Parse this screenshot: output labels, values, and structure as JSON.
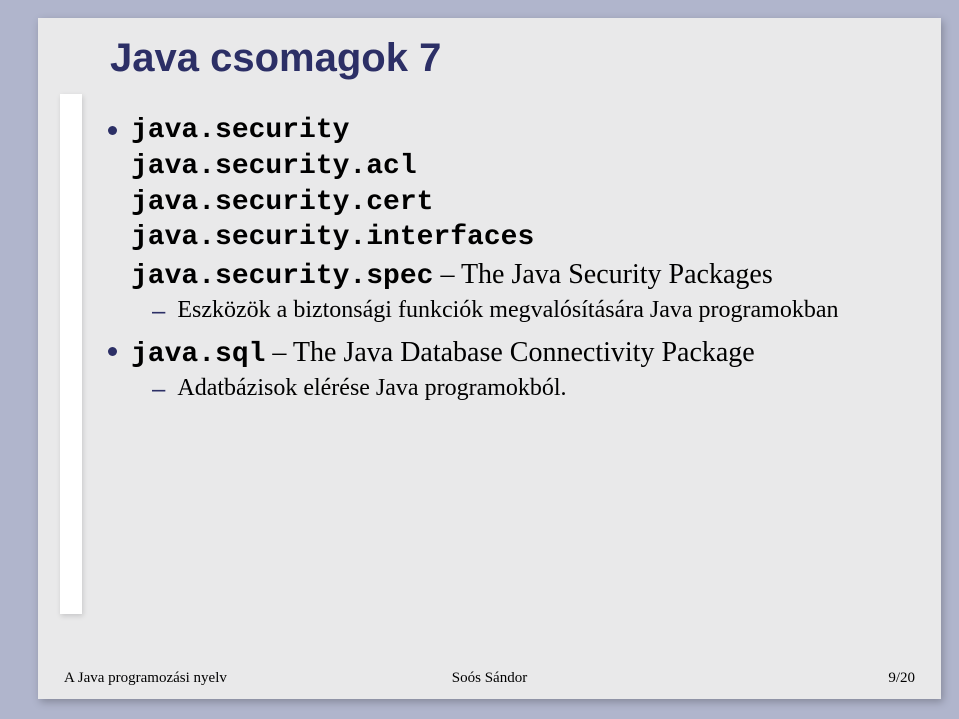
{
  "title": "Java csomagok 7",
  "bullets": [
    {
      "code_lines": [
        "java.security",
        "java.security.acl",
        "java.security.cert",
        "java.security.interfaces"
      ],
      "last_code": "java.security.spec",
      "last_desc": " – The Java Security Packages",
      "sub": "Eszközök a biztonsági funkciók megvalósítására Java programokban"
    },
    {
      "code": "java.sql",
      "desc": " – The Java Database Connectivity Package",
      "sub": "Adatbázisok elérése Java programokból."
    }
  ],
  "footer": {
    "left": "A Java programozási nyelv",
    "center": "Soós Sándor",
    "right": "9/20"
  }
}
